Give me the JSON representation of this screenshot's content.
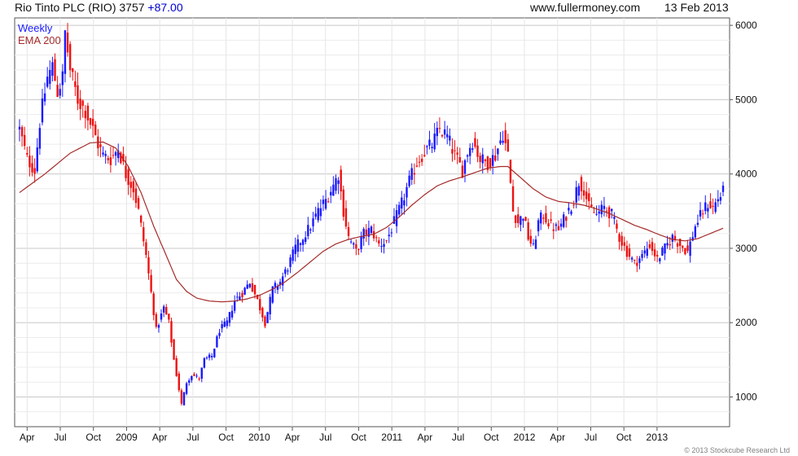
{
  "header": {
    "instrument": "Rio Tinto PLC (RIO) 3757",
    "change": "+87.00",
    "website": "www.fullermoney.com",
    "date": "13 Feb 2013"
  },
  "footer": {
    "copyright": "© 2013 Stockcube Research Ltd"
  },
  "colors": {
    "up": "#1a1aff",
    "down": "#ee1111",
    "ema": "#a52a2a",
    "grid": "#d8d8d8",
    "frame": "#555555"
  },
  "chart_data": {
    "type": "candlestick",
    "legend": [
      {
        "name": "Weekly",
        "color": "#1a1aff"
      },
      {
        "name": "EMA 200",
        "color": "#a52a2a"
      }
    ],
    "ylim": [
      600,
      6100
    ],
    "yticks": [
      1000,
      2000,
      3000,
      4000,
      5000,
      6000
    ],
    "ytick_labels": [
      "1000",
      "2000",
      "3000",
      "4000",
      "5000",
      "6000"
    ],
    "xticks": [
      "Apr",
      "Jul",
      "Oct",
      "2009",
      "Apr",
      "Jul",
      "Oct",
      "2010",
      "Apr",
      "Jul",
      "Oct",
      "2011",
      "Apr",
      "Jul",
      "Oct",
      "2012",
      "Apr",
      "Jul",
      "Oct",
      "2013"
    ],
    "grid": true,
    "series": [
      {
        "name": "Weekly",
        "kind": "weekly close (approx.)",
        "points": [
          [
            0,
            4600
          ],
          [
            3,
            4200
          ],
          [
            6,
            4050
          ],
          [
            8,
            4700
          ],
          [
            11,
            5300
          ],
          [
            13,
            5450
          ],
          [
            15,
            5100
          ],
          [
            17,
            5300
          ],
          [
            18,
            5900
          ],
          [
            20,
            5400
          ],
          [
            23,
            5000
          ],
          [
            26,
            4850
          ],
          [
            29,
            4600
          ],
          [
            31,
            4400
          ],
          [
            33,
            4250
          ],
          [
            36,
            4200
          ],
          [
            39,
            4350
          ],
          [
            42,
            4000
          ],
          [
            45,
            3800
          ],
          [
            47,
            3500
          ],
          [
            50,
            2900
          ],
          [
            52,
            2400
          ],
          [
            54,
            1900
          ],
          [
            57,
            2200
          ],
          [
            59,
            2000
          ],
          [
            61,
            1500
          ],
          [
            63,
            1100
          ],
          [
            64,
            900
          ],
          [
            66,
            1200
          ],
          [
            68,
            1300
          ],
          [
            71,
            1250
          ],
          [
            73,
            1500
          ],
          [
            76,
            1550
          ],
          [
            79,
            1900
          ],
          [
            82,
            2000
          ],
          [
            85,
            2300
          ],
          [
            88,
            2400
          ],
          [
            91,
            2550
          ],
          [
            94,
            2300
          ],
          [
            97,
            2000
          ],
          [
            100,
            2450
          ],
          [
            103,
            2550
          ],
          [
            106,
            2750
          ],
          [
            109,
            3000
          ],
          [
            112,
            3150
          ],
          [
            115,
            3300
          ],
          [
            118,
            3500
          ],
          [
            121,
            3650
          ],
          [
            124,
            3850
          ],
          [
            126,
            4000
          ],
          [
            128,
            3500
          ],
          [
            130,
            3150
          ],
          [
            133,
            2950
          ],
          [
            136,
            3200
          ],
          [
            139,
            3250
          ],
          [
            142,
            3050
          ],
          [
            145,
            3100
          ],
          [
            148,
            3350
          ],
          [
            151,
            3600
          ],
          [
            154,
            3900
          ],
          [
            157,
            4150
          ],
          [
            160,
            4300
          ],
          [
            163,
            4400
          ],
          [
            166,
            4600
          ],
          [
            169,
            4500
          ],
          [
            172,
            4250
          ],
          [
            175,
            4050
          ],
          [
            177,
            4300
          ],
          [
            179,
            4450
          ],
          [
            182,
            4200
          ],
          [
            185,
            4150
          ],
          [
            188,
            4250
          ],
          [
            191,
            4550
          ],
          [
            193,
            4250
          ],
          [
            195,
            3500
          ],
          [
            197,
            3350
          ],
          [
            199,
            3450
          ],
          [
            201,
            3150
          ],
          [
            203,
            3000
          ],
          [
            205,
            3350
          ],
          [
            207,
            3450
          ],
          [
            210,
            3300
          ],
          [
            213,
            3250
          ],
          [
            216,
            3450
          ],
          [
            219,
            3650
          ],
          [
            221,
            3900
          ],
          [
            223,
            3800
          ],
          [
            225,
            3550
          ],
          [
            228,
            3450
          ],
          [
            231,
            3550
          ],
          [
            234,
            3450
          ],
          [
            237,
            3150
          ],
          [
            240,
            2950
          ],
          [
            243,
            2800
          ],
          [
            246,
            2900
          ],
          [
            249,
            3050
          ],
          [
            252,
            2850
          ],
          [
            255,
            3000
          ],
          [
            258,
            3150
          ],
          [
            261,
            3050
          ],
          [
            264,
            2950
          ],
          [
            267,
            3300
          ],
          [
            270,
            3500
          ],
          [
            272,
            3600
          ],
          [
            274,
            3550
          ],
          [
            276,
            3670
          ],
          [
            278,
            3757
          ]
        ]
      },
      {
        "name": "EMA 200",
        "kind": "line",
        "points": [
          [
            0,
            3750
          ],
          [
            10,
            4000
          ],
          [
            20,
            4280
          ],
          [
            28,
            4420
          ],
          [
            33,
            4430
          ],
          [
            38,
            4350
          ],
          [
            43,
            4100
          ],
          [
            48,
            3750
          ],
          [
            53,
            3300
          ],
          [
            58,
            2900
          ],
          [
            62,
            2580
          ],
          [
            66,
            2420
          ],
          [
            70,
            2330
          ],
          [
            75,
            2290
          ],
          [
            80,
            2280
          ],
          [
            85,
            2290
          ],
          [
            90,
            2320
          ],
          [
            95,
            2370
          ],
          [
            100,
            2450
          ],
          [
            105,
            2550
          ],
          [
            110,
            2680
          ],
          [
            115,
            2820
          ],
          [
            120,
            2960
          ],
          [
            125,
            3060
          ],
          [
            130,
            3120
          ],
          [
            135,
            3160
          ],
          [
            140,
            3190
          ],
          [
            145,
            3280
          ],
          [
            150,
            3420
          ],
          [
            155,
            3580
          ],
          [
            160,
            3720
          ],
          [
            165,
            3840
          ],
          [
            170,
            3910
          ],
          [
            175,
            3960
          ],
          [
            180,
            4020
          ],
          [
            185,
            4080
          ],
          [
            190,
            4100
          ],
          [
            193,
            4100
          ],
          [
            198,
            3950
          ],
          [
            203,
            3800
          ],
          [
            208,
            3690
          ],
          [
            213,
            3630
          ],
          [
            218,
            3610
          ],
          [
            223,
            3580
          ],
          [
            228,
            3530
          ],
          [
            233,
            3470
          ],
          [
            238,
            3390
          ],
          [
            243,
            3310
          ],
          [
            248,
            3250
          ],
          [
            253,
            3180
          ],
          [
            258,
            3120
          ],
          [
            263,
            3100
          ],
          [
            268,
            3130
          ],
          [
            273,
            3200
          ],
          [
            278,
            3270
          ]
        ]
      }
    ]
  }
}
